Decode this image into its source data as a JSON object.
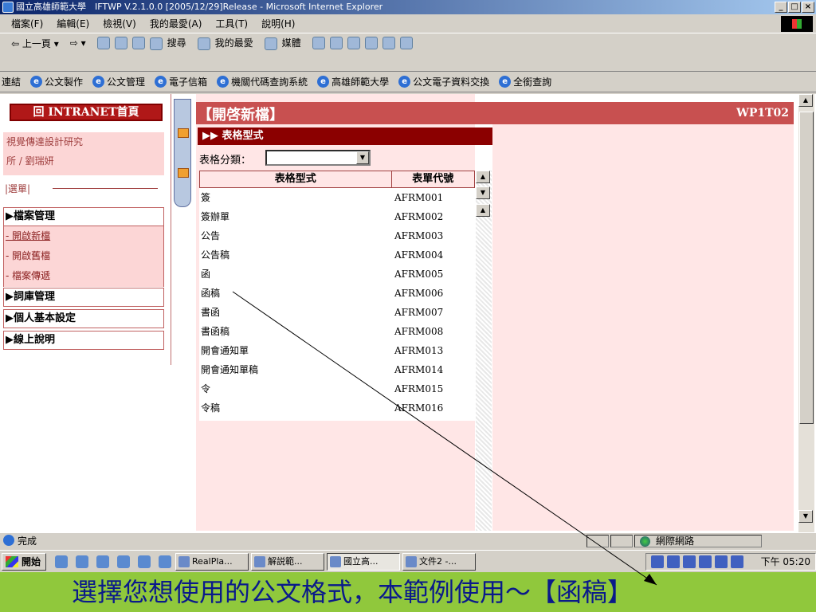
{
  "window": {
    "title": "國立高雄師範大學　IFTWP V.2.1.0.0 [2005/12/29]Release - Microsoft Internet Explorer"
  },
  "menubar": [
    "檔案(F)",
    "編輯(E)",
    "檢視(V)",
    "我的最愛(A)",
    "工具(T)",
    "說明(H)"
  ],
  "toolbar": {
    "back": "上一頁",
    "search": "搜尋",
    "favorites": "我的最愛",
    "media": "媒體"
  },
  "links": {
    "label": "連結",
    "items": [
      "公文製作",
      "公文管理",
      "電子信箱",
      "機關代碼查詢系統",
      "高雄師範大學",
      "公文電子資料交換",
      "全銜查詢"
    ]
  },
  "nav": {
    "home": "回 INTRANET首頁",
    "user_line1": "視覺傳達設計研究",
    "user_line2": "所 / 劉瑞妍",
    "menu_label": "|選單|",
    "sections": [
      {
        "label": "▶檔案管理",
        "items": [
          "- 開啟新檔",
          "- 開啟舊檔",
          "- 檔案傳遞"
        ]
      },
      {
        "label": "▶詞庫管理"
      },
      {
        "label": "▶個人基本設定"
      },
      {
        "label": "▶線上說明"
      }
    ]
  },
  "page": {
    "title": "【開啓新檔】",
    "code": "WP1T02",
    "section": "▶▶ 表格型式",
    "filter_label": "表格分類：",
    "col_form": "表格型式",
    "col_code": "表單代號",
    "rows": [
      {
        "name": "簽",
        "code": "AFRM001"
      },
      {
        "name": "簽辦單",
        "code": "AFRM002"
      },
      {
        "name": "公告",
        "code": "AFRM003"
      },
      {
        "name": "公告稿",
        "code": "AFRM004"
      },
      {
        "name": "函",
        "code": "AFRM005"
      },
      {
        "name": "函稿",
        "code": "AFRM006"
      },
      {
        "name": "書函",
        "code": "AFRM007"
      },
      {
        "name": "書函稿",
        "code": "AFRM008"
      },
      {
        "name": "開會通知單",
        "code": "AFRM013"
      },
      {
        "name": "開會通知單稿",
        "code": "AFRM014"
      },
      {
        "name": "令",
        "code": "AFRM015"
      },
      {
        "name": "令稿",
        "code": "AFRM016"
      }
    ]
  },
  "status": {
    "text": "完成",
    "zone": "網際網路"
  },
  "taskbar": {
    "start": "開始",
    "tasks": [
      "RealPla...",
      "解説範...",
      "國立高...",
      "文件2 -..."
    ],
    "clock": "下午 05:20"
  },
  "caption": "選擇您想使用的公文格式，本範例使用～【函稿】",
  "colors": {
    "accent": "#c85050",
    "dark_red": "#8b0000",
    "pink": "#ffe6e6",
    "caption_bg": "#90c83c",
    "caption_text": "#0a1a8a"
  }
}
